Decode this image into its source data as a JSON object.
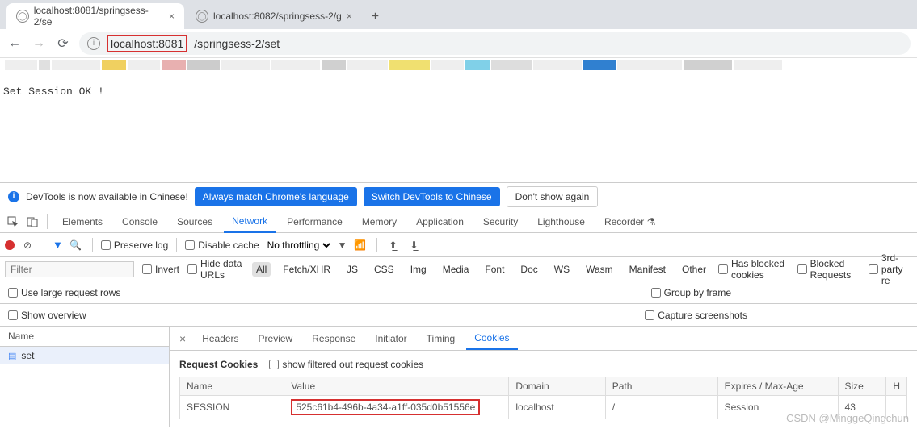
{
  "browser": {
    "tabs": [
      {
        "title": "localhost:8081/springsess-2/se",
        "active": true
      },
      {
        "title": "localhost:8082/springsess-2/g",
        "active": false
      }
    ],
    "url": {
      "highlight": "localhost:8081",
      "rest": "/springsess-2/set"
    }
  },
  "page": {
    "body_text": "Set Session OK !"
  },
  "devtools": {
    "notice": {
      "text": "DevTools is now available in Chinese!",
      "btn_match": "Always match Chrome's language",
      "btn_switch": "Switch DevTools to Chinese",
      "btn_dont": "Don't show again"
    },
    "tabs": [
      "Elements",
      "Console",
      "Sources",
      "Network",
      "Performance",
      "Memory",
      "Application",
      "Security",
      "Lighthouse",
      "Recorder"
    ],
    "active_tab": "Network",
    "recorder_preview": "⚗",
    "network_toolbar": {
      "preserve_log": "Preserve log",
      "disable_cache": "Disable cache",
      "throttling": "No throttling"
    },
    "filter": {
      "placeholder": "Filter",
      "invert": "Invert",
      "hide_data": "Hide data URLs",
      "types": [
        "All",
        "Fetch/XHR",
        "JS",
        "CSS",
        "Img",
        "Media",
        "Font",
        "Doc",
        "WS",
        "Wasm",
        "Manifest",
        "Other"
      ],
      "active_type": "All",
      "has_blocked": "Has blocked cookies",
      "blocked_requests": "Blocked Requests",
      "third_party": "3rd-party re"
    },
    "options": {
      "large_rows": "Use large request rows",
      "show_overview": "Show overview",
      "group_frame": "Group by frame",
      "capture_ss": "Capture screenshots"
    },
    "request_list": {
      "header": "Name",
      "items": [
        "set"
      ]
    },
    "detail": {
      "tabs": [
        "Headers",
        "Preview",
        "Response",
        "Initiator",
        "Timing",
        "Cookies"
      ],
      "active": "Cookies",
      "section_title": "Request Cookies",
      "show_filtered": "show filtered out request cookies",
      "columns": [
        "Name",
        "Value",
        "Domain",
        "Path",
        "Expires / Max-Age",
        "Size",
        "H"
      ],
      "row": {
        "name": "SESSION",
        "value": "525c61b4-496b-4a34-a1ff-035d0b51556e",
        "domain": "localhost",
        "path": "/",
        "expires": "Session",
        "size": "43"
      }
    }
  },
  "watermark": "CSDN @MinggeQingchun"
}
